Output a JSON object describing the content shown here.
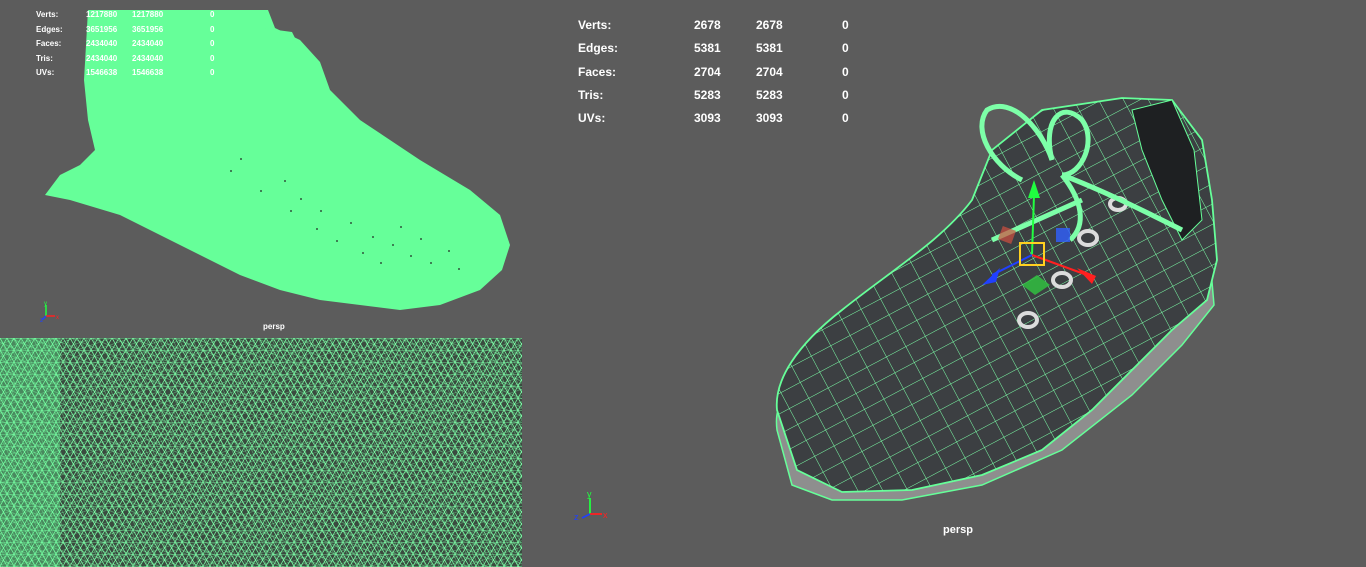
{
  "left_top_viewport": {
    "camera_label": "persp",
    "stats": {
      "rows": [
        {
          "label": "Verts:",
          "v1": "1217880",
          "v2": "1217880",
          "v3": "0"
        },
        {
          "label": "Edges:",
          "v1": "3651956",
          "v2": "3651956",
          "v3": "0"
        },
        {
          "label": "Faces:",
          "v1": "2434040",
          "v2": "2434040",
          "v3": "0"
        },
        {
          "label": "Tris:",
          "v1": "2434040",
          "v2": "2434040",
          "v3": "0"
        },
        {
          "label": "UVs:",
          "v1": "1546638",
          "v2": "1546638",
          "v3": "0"
        }
      ]
    },
    "axis": {
      "x": "x",
      "y": "y",
      "z": "z"
    }
  },
  "right_viewport": {
    "camera_label": "persp",
    "stats": {
      "rows": [
        {
          "label": "Verts:",
          "v1": "2678",
          "v2": "2678",
          "v3": "0"
        },
        {
          "label": "Edges:",
          "v1": "5381",
          "v2": "5381",
          "v3": "0"
        },
        {
          "label": "Faces:",
          "v1": "2704",
          "v2": "2704",
          "v3": "0"
        },
        {
          "label": "Tris:",
          "v1": "5283",
          "v2": "5283",
          "v3": "0"
        },
        {
          "label": "UVs:",
          "v1": "3093",
          "v2": "3093",
          "v3": "0"
        }
      ]
    },
    "axis": {
      "x": "x",
      "y": "y",
      "z": "z"
    }
  },
  "colors": {
    "viewport_bg": "#5c5c5c",
    "mesh_green": "#66ff99",
    "wire_green": "#7dffa8",
    "axis_x": "#ff2020",
    "axis_y": "#20ff40",
    "axis_z": "#2040ff",
    "gizmo_center": "#ffd020"
  },
  "icons": [
    "axis-gizmo-icon",
    "move-manipulator-icon"
  ]
}
